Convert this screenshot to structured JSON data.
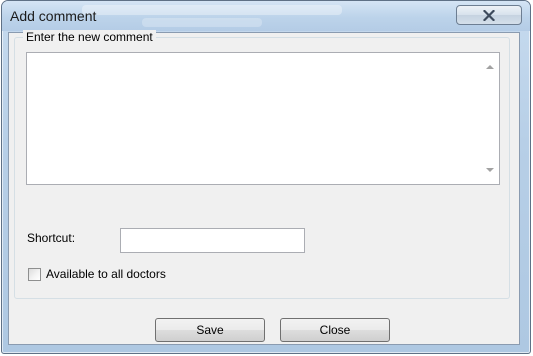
{
  "window": {
    "title": "Add comment",
    "close_icon": "close-x-icon"
  },
  "comment_group": {
    "legend": "Enter the new comment",
    "comment_value": ""
  },
  "shortcut": {
    "label": "Shortcut:",
    "value": ""
  },
  "available_checkbox": {
    "label": "Available to all doctors",
    "checked": false
  },
  "buttons": {
    "save": "Save",
    "close": "Close"
  },
  "colors": {
    "titlebar": "#bcd3ea",
    "client_background": "#f0f0f0",
    "groupbox_border": "#d5dfe5"
  }
}
